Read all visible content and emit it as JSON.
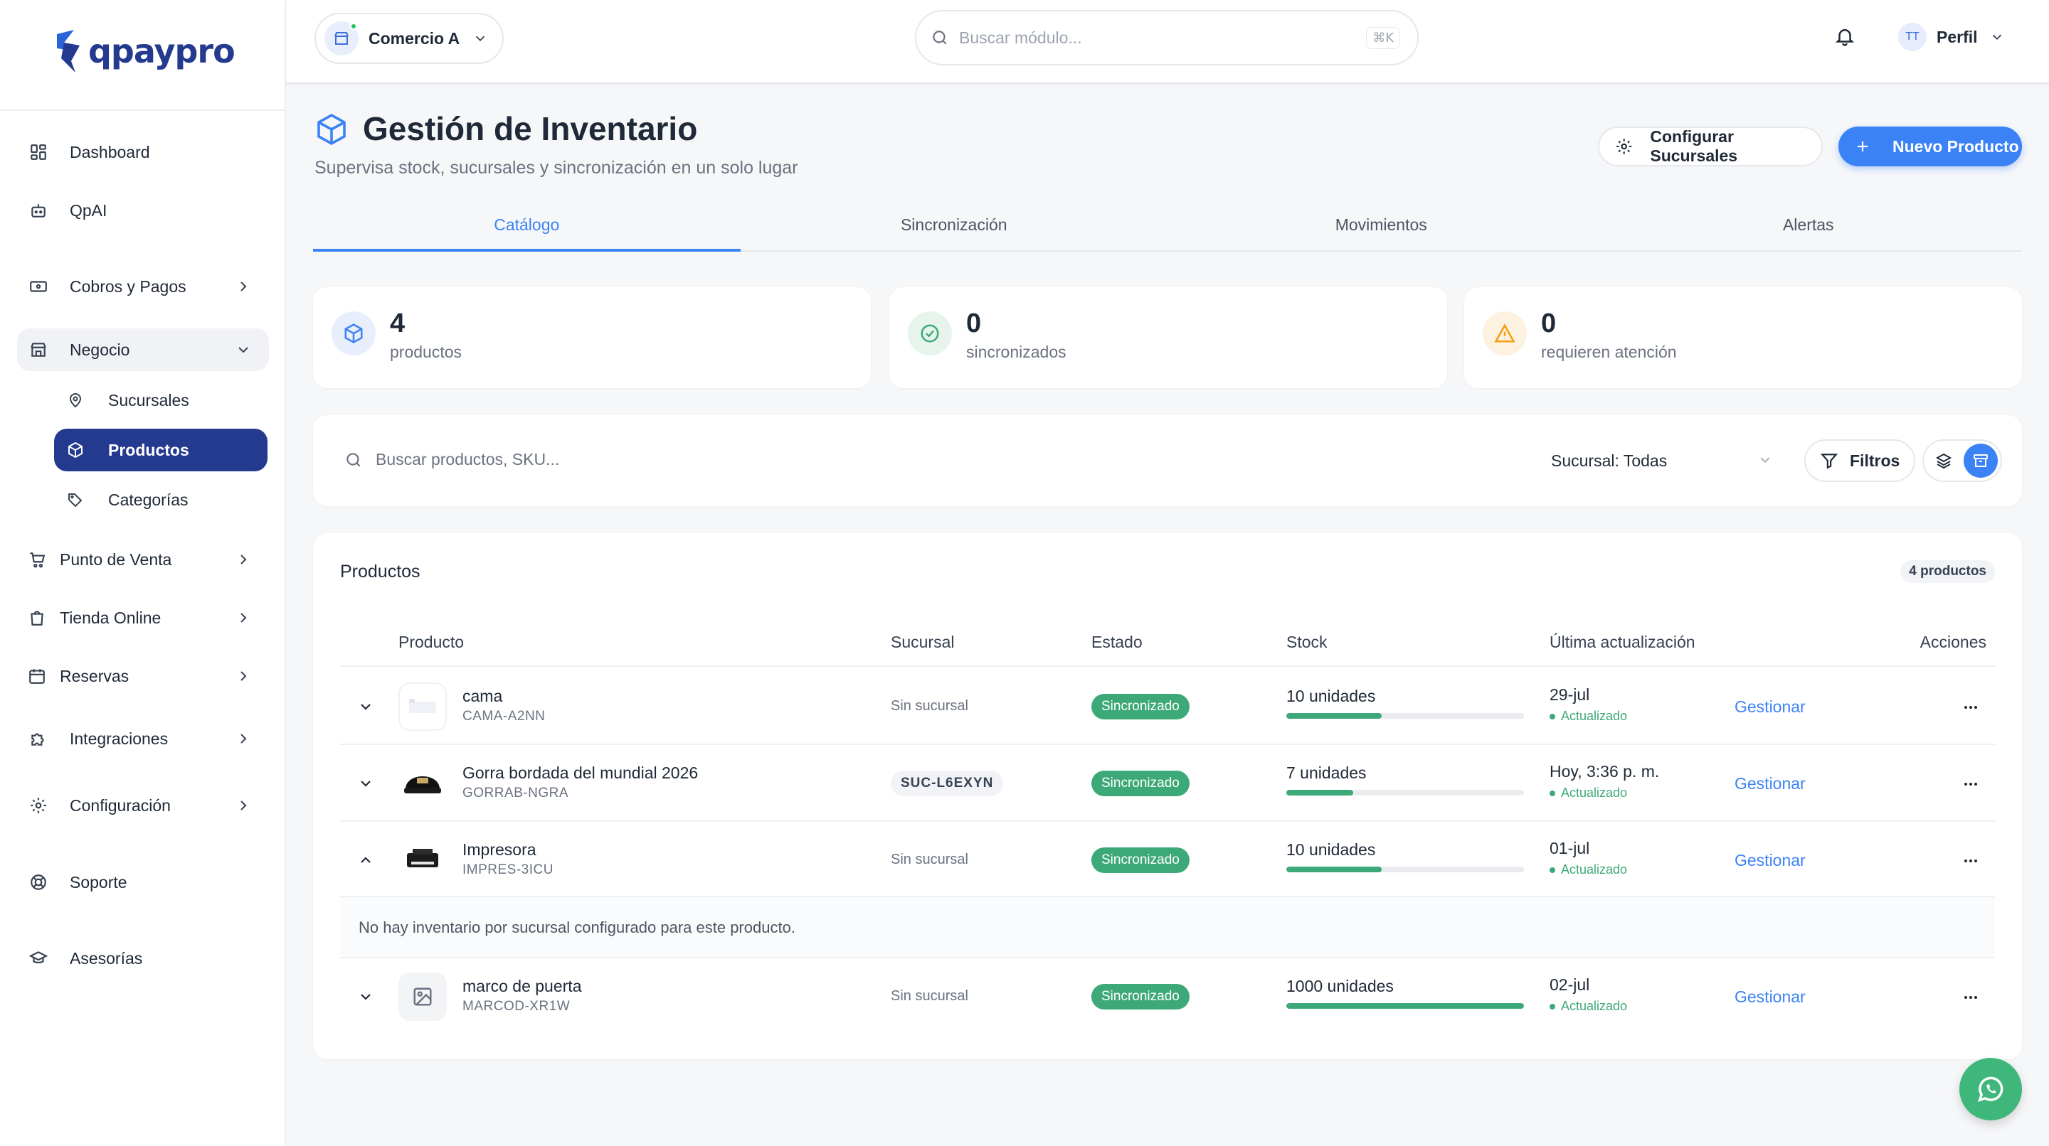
{
  "brand": {
    "logo_text": "qpaypro",
    "accent": "#243a8f"
  },
  "sidebar": {
    "items": [
      {
        "label": "Dashboard",
        "icon": "grid-icon"
      },
      {
        "label": "QpAI",
        "icon": "robot-icon"
      },
      {
        "label": "Cobros y Pagos",
        "icon": "cash-icon"
      },
      {
        "label": "Negocio",
        "icon": "store-icon"
      },
      {
        "label": "Punto de Venta",
        "icon": "cart-icon"
      },
      {
        "label": "Tienda Online",
        "icon": "bag-icon"
      },
      {
        "label": "Reservas",
        "icon": "calendar-icon"
      },
      {
        "label": "Integraciones",
        "icon": "puzzle-icon"
      },
      {
        "label": "Configuración",
        "icon": "gear-icon"
      },
      {
        "label": "Soporte",
        "icon": "lifebuoy-icon"
      },
      {
        "label": "Asesorías",
        "icon": "graduation-cap-icon"
      }
    ],
    "sub_items": [
      {
        "label": "Sucursales",
        "icon": "map-pin-icon"
      },
      {
        "label": "Productos",
        "icon": "box-icon",
        "active": true
      },
      {
        "label": "Categorías",
        "icon": "tags-icon"
      }
    ]
  },
  "topbar": {
    "store_name": "Comercio A",
    "search_placeholder": "Buscar módulo...",
    "search_shortcut": "⌘K",
    "avatar_initials": "TT",
    "profile_label": "Perfil"
  },
  "header": {
    "title": "Gestión de Inventario",
    "subtitle": "Supervisa stock, sucursales y sincronización en un solo lugar",
    "config_button": "Configurar Sucursales",
    "new_button": "Nuevo Producto"
  },
  "tabs": [
    {
      "label": "Catálogo",
      "active": true
    },
    {
      "label": "Sincronización"
    },
    {
      "label": "Movimientos"
    },
    {
      "label": "Alertas"
    }
  ],
  "stats": [
    {
      "value": "4",
      "label": "productos",
      "color": "#3b82f6"
    },
    {
      "value": "0",
      "label": "sincronizados",
      "color": "#3ea978"
    },
    {
      "value": "0",
      "label": "requieren atención",
      "color": "#f59e0b"
    }
  ],
  "filters": {
    "search_placeholder": "Buscar productos, SKU...",
    "branch_select": "Sucursal: Todas",
    "filters_button": "Filtros"
  },
  "products_card": {
    "title": "Productos",
    "count_badge": "4 productos",
    "columns": [
      "Producto",
      "Sucursal",
      "Estado",
      "Stock",
      "Última actualización",
      "Acciones"
    ],
    "rows": [
      {
        "name": "cama",
        "sku": "CAMA-A2NN",
        "branch": "Sin sucursal",
        "status": "Sincronizado",
        "stock": "10 unidades",
        "stock_level": 0.4,
        "date": "29-jul",
        "update_state": "Actualizado",
        "action": "Gestionar",
        "expanded": false
      },
      {
        "name": "Gorra bordada del mundial 2026",
        "sku": "GORRAB-NGRA",
        "branch": "SUC-L6EXYN",
        "status": "Sincronizado",
        "stock": "7 unidades",
        "stock_level": 0.28,
        "date": "Hoy, 3:36 p. m.",
        "update_state": "Actualizado",
        "action": "Gestionar",
        "expanded": false
      },
      {
        "name": "Impresora",
        "sku": "IMPRES-3ICU",
        "branch": "Sin sucursal",
        "status": "Sincronizado",
        "stock": "10 unidades",
        "stock_level": 0.4,
        "date": "01-jul",
        "update_state": "Actualizado",
        "action": "Gestionar",
        "expanded": true
      },
      {
        "name": "marco de puerta",
        "sku": "MARCOD-XR1W",
        "branch": "Sin sucursal",
        "status": "Sincronizado",
        "stock": "1000 unidades",
        "stock_level": 1.0,
        "date": "02-jul",
        "update_state": "Actualizado",
        "action": "Gestionar",
        "expanded": false
      }
    ],
    "expanded_note": "No hay inventario por sucursal configurado para este producto."
  },
  "colors": {
    "primary": "#3b82f6",
    "success": "#3ea978",
    "warning": "#f59e0b"
  }
}
